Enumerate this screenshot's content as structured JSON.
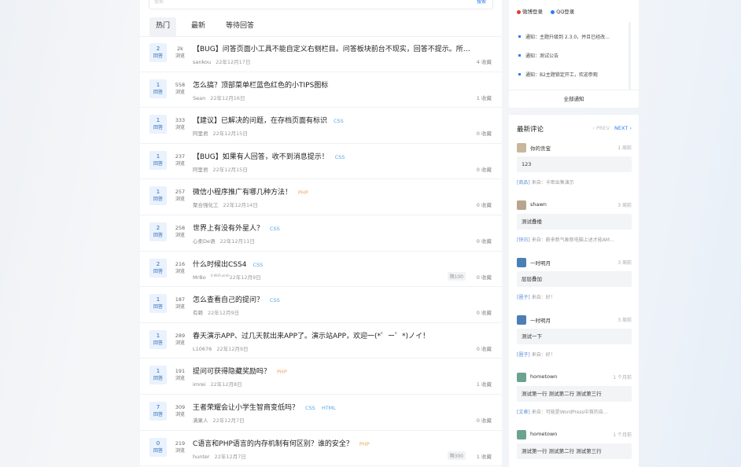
{
  "search": {
    "placeholder": "搜索",
    "button": "搜索"
  },
  "tabs": [
    {
      "label": "热门"
    },
    {
      "label": "最新"
    },
    {
      "label": "等待回答"
    }
  ],
  "questions": [
    {
      "answers": "2",
      "answers_label": "回答",
      "views": "2k",
      "views_label": "浏览",
      "title": "【BUG】问答页面小工具不能自定义右侧栏目。问答板块前台不现实，回答不提示。所…",
      "tags": [],
      "author": "sankou",
      "date": "22年12月17日",
      "favs": "4 收藏",
      "bounty": ""
    },
    {
      "answers": "1",
      "answers_label": "回答",
      "views": "558",
      "views_label": "浏览",
      "title": "怎么搞？顶部菜单栏蓝色红色的小TIPS图标",
      "tags": [],
      "author": "Sean",
      "date": "22年12月16日",
      "favs": "1 收藏",
      "bounty": ""
    },
    {
      "answers": "1",
      "answers_label": "回答",
      "views": "333",
      "views_label": "浏览",
      "title": "【建议】已解决的问题，在存档页面有标识",
      "tags": [
        {
          "text": "CSS",
          "kind": "css"
        }
      ],
      "author": "阿里君",
      "date": "22年12月15日",
      "favs": "0 收藏",
      "bounty": ""
    },
    {
      "answers": "1",
      "answers_label": "回答",
      "views": "237",
      "views_label": "浏览",
      "title": "【BUG】如果有人回答，收不到消息提示！",
      "tags": [
        {
          "text": "CSS",
          "kind": "css"
        }
      ],
      "author": "阿里君",
      "date": "22年12月15日",
      "favs": "0 收藏",
      "bounty": ""
    },
    {
      "answers": "1",
      "answers_label": "回答",
      "views": "257",
      "views_label": "浏览",
      "title": "微信小程序推广有哪几种方法！",
      "tags": [
        {
          "text": "PHP",
          "kind": "php"
        }
      ],
      "author": "聚合强化工",
      "date": "22年12月14日",
      "favs": "0 收藏",
      "bounty": ""
    },
    {
      "answers": "2",
      "answers_label": "回答",
      "views": "258",
      "views_label": "浏览",
      "title": "世界上有没有外星人？",
      "tags": [
        {
          "text": "CSS",
          "kind": "css"
        }
      ],
      "author": "心柔De语",
      "date": "22年12月11日",
      "favs": "0 收藏",
      "bounty": ""
    },
    {
      "answers": "2",
      "answers_label": "回答",
      "views": "216",
      "views_label": "浏览",
      "title": "什么时候出CSS4",
      "tags": [
        {
          "text": "CSS",
          "kind": "css"
        }
      ],
      "author": "MrBo",
      "author_sup": "0.9K/Funroll",
      "date": "22年12月9日",
      "favs": "0 收藏",
      "bounty": "隔100"
    },
    {
      "answers": "1",
      "answers_label": "回答",
      "views": "187",
      "views_label": "浏览",
      "title": "怎么查看自己的提问？",
      "tags": [
        {
          "text": "CSS",
          "kind": "css"
        }
      ],
      "author": "有赖",
      "date": "22年12月9日",
      "favs": "0 收藏",
      "bounty": ""
    },
    {
      "answers": "1",
      "answers_label": "回答",
      "views": "289",
      "views_label": "浏览",
      "title": "春天演示APP、过几天就出来APP了。演示站APP，欢迎一(*゜ー゜*)ノイ！",
      "tags": [],
      "author": "L10676",
      "date": "22年12月9日",
      "favs": "0 收藏",
      "bounty": ""
    },
    {
      "answers": "1",
      "answers_label": "回答",
      "views": "191",
      "views_label": "浏览",
      "title": "提问可获得隐藏奖励吗？",
      "tags": [
        {
          "text": "PHP",
          "kind": "php"
        }
      ],
      "author": "imrei",
      "date": "22年12月8日",
      "favs": "1 收藏",
      "bounty": ""
    },
    {
      "answers": "7",
      "answers_label": "回答",
      "views": "309",
      "views_label": "浏览",
      "title": "王者荣耀会让小学生智商变低吗？",
      "tags": [
        {
          "text": "CSS",
          "kind": "css"
        },
        {
          "text": "HTML",
          "kind": "html"
        }
      ],
      "author": "满果人",
      "date": "22年12月7日",
      "favs": "0 收藏",
      "bounty": ""
    },
    {
      "answers": "0",
      "answers_label": "回答",
      "views": "219",
      "views_label": "浏览",
      "title": "C语言和PHP语言的内存机制有何区别？谁的安全？",
      "tags": [
        {
          "text": "PHP",
          "kind": "php"
        }
      ],
      "author": "hunter",
      "date": "22年12月7日",
      "favs": "1 收藏",
      "bounty": "隔300"
    }
  ],
  "sidebar": {
    "login": {
      "weibo": "微博登录",
      "qq": "QQ登录",
      "weibo_color": "#e53935",
      "qq_color": "#2f7cf6"
    },
    "notices": [
      "通知：主题升级到 2.3.0，并且已经改…",
      "通知：测试公告",
      "通知：B2主题锁定开工，欢迎参观"
    ],
    "all_notices": "全部通知",
    "comments_title": "最新评论",
    "prev": "‹ PREV",
    "next": "NEXT ›",
    "comments": [
      {
        "name": "你的贪宝",
        "time": "1 周前",
        "text": "123",
        "cat": "[商品]",
        "src": "来自：卡密出售演示",
        "avatar": "#c9b79b"
      },
      {
        "name": "shawn",
        "time": "3 周前",
        "text": "测试叠楼",
        "cat": "[快讯]",
        "src": "来自：蔚来新气象新电脑上述才能AM…",
        "avatar": "#b7a58e"
      },
      {
        "name": "一时明月",
        "time": "3 周前",
        "text": "层层叠加",
        "cat": "[圈子]",
        "src": "来自：好！",
        "avatar": "#4b7fb5"
      },
      {
        "name": "一时明月",
        "time": "3 周前",
        "text": "测试一下",
        "cat": "[圈子]",
        "src": "来自：好！",
        "avatar": "#4b7fb5"
      },
      {
        "name": "hometown",
        "time": "1 个月前",
        "text": "测试第一行 测试第二行 测试第三行",
        "cat": "[文章]",
        "src": "来自：可能是WordPress中首的自…",
        "avatar": "#6aa48f"
      },
      {
        "name": "hometown",
        "time": "1 个月前",
        "text": "测试第一行 测试第二行 测试第三行",
        "cat": "",
        "src": "",
        "avatar": "#6aa48f"
      }
    ]
  }
}
